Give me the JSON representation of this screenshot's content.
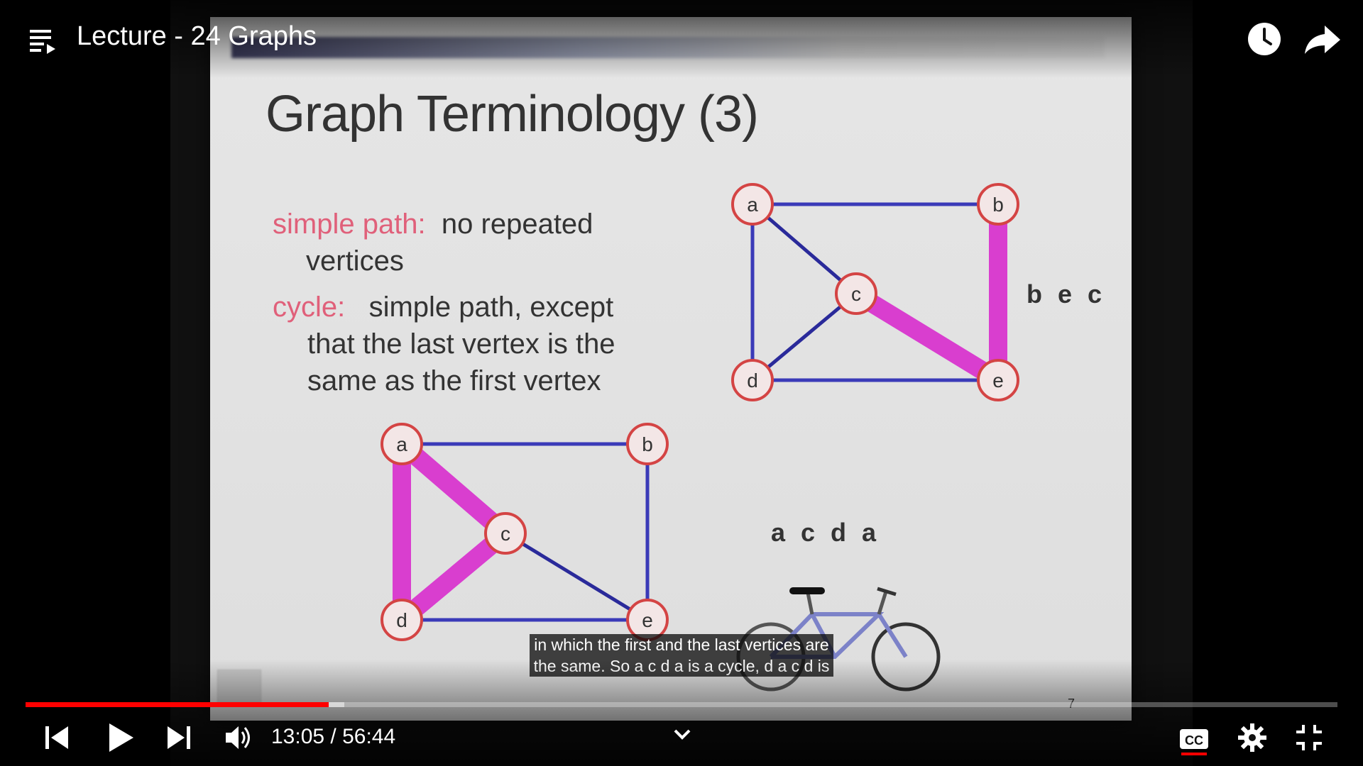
{
  "header": {
    "title": "Lecture - 24 Graphs",
    "playlist_icon": "playlist-icon",
    "watch_later_icon": "clock-icon",
    "share_icon": "share-arrow-icon"
  },
  "slide": {
    "title": "Graph Terminology (3)",
    "simple_path_term": "simple path:",
    "simple_path_def_1": "no repeated",
    "simple_path_def_2": "vertices",
    "cycle_term": "cycle:",
    "cycle_def_1": "simple path, except",
    "cycle_def_2": "that the last vertex is the",
    "cycle_def_3": "same as the first vertex",
    "label_path": "b e c",
    "label_cycle": "a c d a",
    "page_number": "7",
    "graph1_nodes": [
      "a",
      "b",
      "c",
      "d",
      "e"
    ],
    "graph2_nodes": [
      "a",
      "b",
      "c",
      "d",
      "e"
    ]
  },
  "captions": {
    "line_1": "in which the first and the last vertices are",
    "line_2": "the same. So a c d a is a cycle, d a c d is"
  },
  "controls": {
    "time": "13:05 / 56:44",
    "progress_played_pct": 23.1,
    "progress_buffered_pct": 24.3,
    "accent": "#ff0000"
  }
}
